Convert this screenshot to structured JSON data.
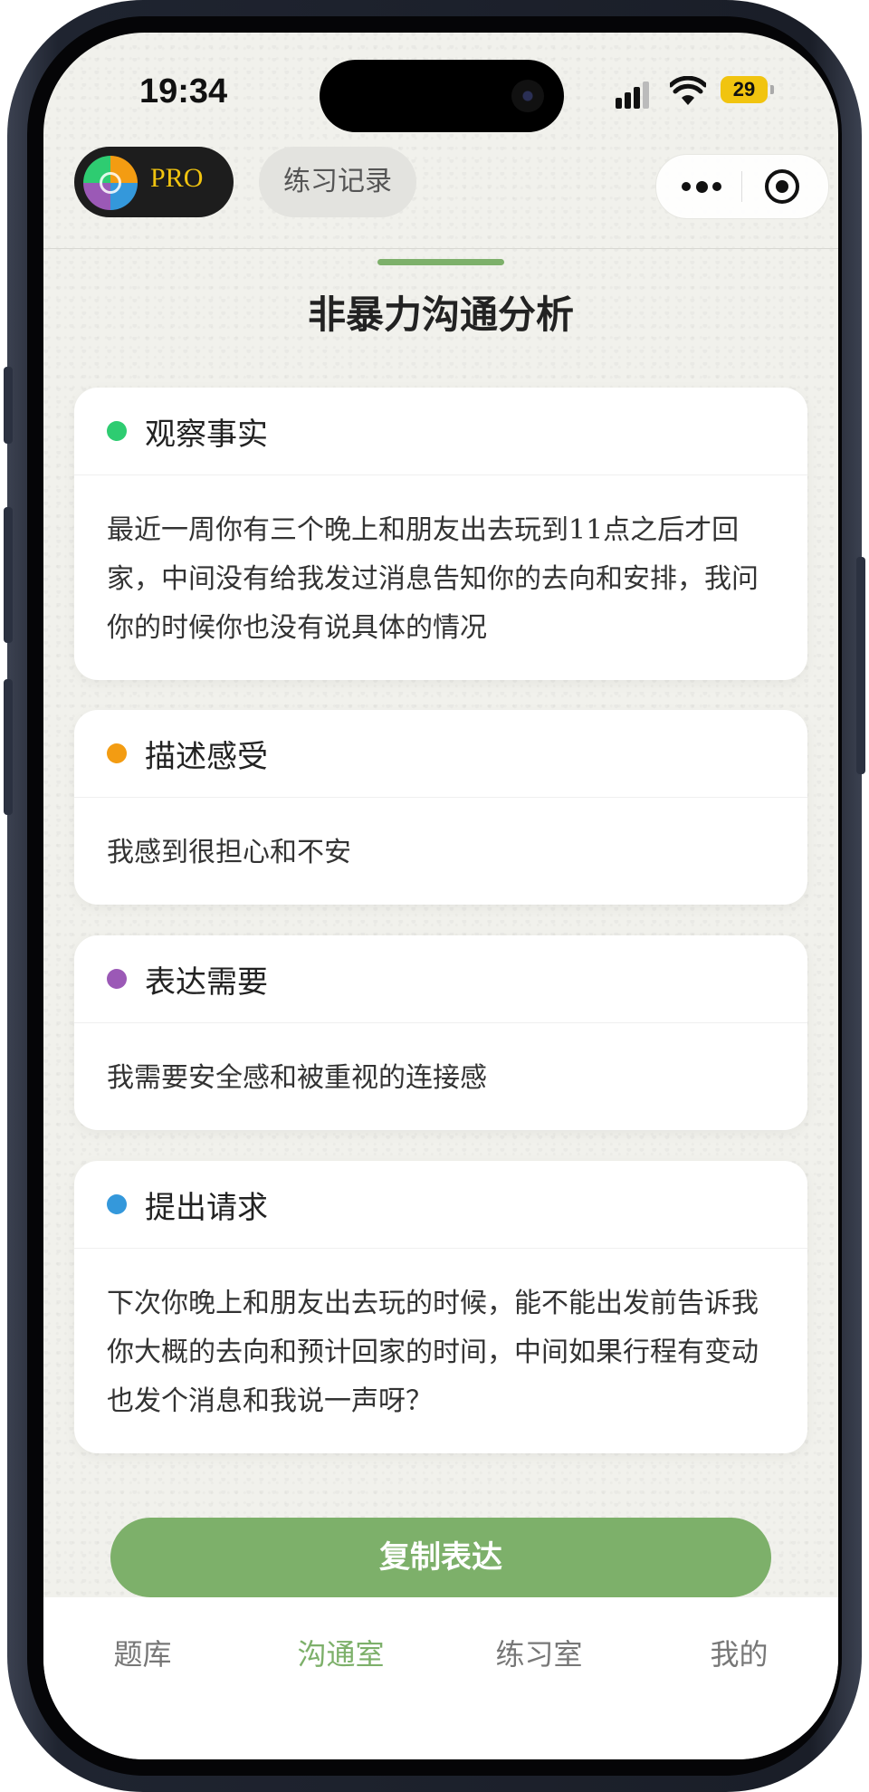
{
  "status_bar": {
    "time": "19:34",
    "battery": "29"
  },
  "header": {
    "pro_label": "PRO",
    "record_button": "练习记录"
  },
  "page": {
    "title": "非暴力沟通分析"
  },
  "cards": [
    {
      "title": "观察事实",
      "color": "#2ecc71",
      "text": "最近一周你有三个晚上和朋友出去玩到11点之后才回家，中间没有给我发过消息告知你的去向和安排，我问你的时候你也没有说具体的情况"
    },
    {
      "title": "描述感受",
      "color": "#f39c12",
      "text": "我感到很担心和不安"
    },
    {
      "title": "表达需要",
      "color": "#9b59b6",
      "text": "我需要安全感和被重视的连接感"
    },
    {
      "title": "提出请求",
      "color": "#3498db",
      "text": "下次你晚上和朋友出去玩的时候，能不能出发前告诉我你大概的去向和预计回家的时间，中间如果行程有变动也发个消息和我说一声呀？"
    }
  ],
  "copy_button": "复制表达",
  "tabs": [
    {
      "label": "题库",
      "active": false
    },
    {
      "label": "沟通室",
      "active": true
    },
    {
      "label": "练习室",
      "active": false
    },
    {
      "label": "我的",
      "active": false
    }
  ],
  "accent_color": "#7db06a"
}
